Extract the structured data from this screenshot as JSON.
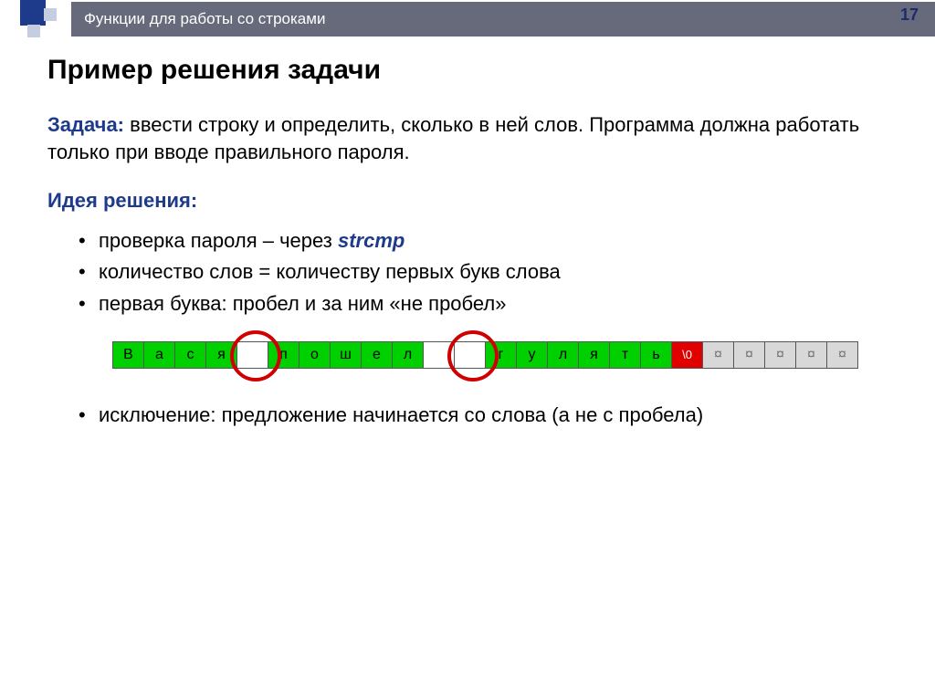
{
  "page_number": "17",
  "header": {
    "title": "Функции для работы со строками"
  },
  "title": "Пример решения задачи",
  "task": {
    "label": "Задача:",
    "text": "ввести строку и определить, сколько в ней слов. Программа должна работать только при вводе правильного пароля."
  },
  "idea": {
    "label": "Идея решения:",
    "items": [
      {
        "prefix": "проверка пароля – через ",
        "kw": "strcmp"
      },
      {
        "text": "количество слов = количеству первых букв слова"
      },
      {
        "text": "первая буква: пробел и за ним «не пробел»"
      },
      {
        "text": "исключение: предложение начинается со слова (а не с пробела)"
      }
    ]
  },
  "string_cells": [
    {
      "c": "В",
      "k": "green"
    },
    {
      "c": "а",
      "k": "green"
    },
    {
      "c": "с",
      "k": "green"
    },
    {
      "c": "я",
      "k": "green"
    },
    {
      "c": " ",
      "k": "white"
    },
    {
      "c": "п",
      "k": "green"
    },
    {
      "c": "о",
      "k": "green"
    },
    {
      "c": "ш",
      "k": "green"
    },
    {
      "c": "е",
      "k": "green"
    },
    {
      "c": "л",
      "k": "green"
    },
    {
      "c": " ",
      "k": "white"
    },
    {
      "c": " ",
      "k": "white"
    },
    {
      "c": "г",
      "k": "green"
    },
    {
      "c": "у",
      "k": "green"
    },
    {
      "c": "л",
      "k": "green"
    },
    {
      "c": "я",
      "k": "green"
    },
    {
      "c": "т",
      "k": "green"
    },
    {
      "c": "ь",
      "k": "green"
    },
    {
      "c": "\\0",
      "k": "red"
    },
    {
      "c": "¤",
      "k": "grey"
    },
    {
      "c": "¤",
      "k": "grey"
    },
    {
      "c": "¤",
      "k": "grey"
    },
    {
      "c": "¤",
      "k": "grey"
    },
    {
      "c": "¤",
      "k": "grey"
    }
  ]
}
